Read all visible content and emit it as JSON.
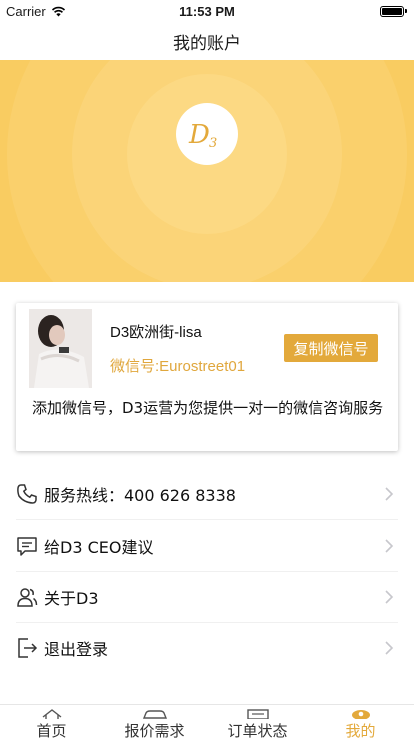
{
  "status_bar": {
    "carrier": "Carrier",
    "time": "11:53 PM"
  },
  "nav": {
    "title": "我的账户"
  },
  "banner": {
    "logo_text": "D3"
  },
  "profile_card": {
    "name": "D3欧洲街-lisa",
    "wechat_id": "微信号:Eurostreet01",
    "copy_button": "复制微信号",
    "description": "添加微信号，D3运营为您提供一对一的微信咨询服务"
  },
  "menu": [
    {
      "label": "服务热线：400 626 8338",
      "icon": "phone-icon"
    },
    {
      "label": "给D3 CEO建议",
      "icon": "chat-icon"
    },
    {
      "label": "关于D3",
      "icon": "users-icon"
    },
    {
      "label": "退出登录",
      "icon": "logout-icon"
    }
  ],
  "tabs": [
    {
      "label": "首页",
      "icon": "home-icon"
    },
    {
      "label": "报价需求",
      "icon": "car-icon"
    },
    {
      "label": "订单状态",
      "icon": "order-icon"
    },
    {
      "label": "我的",
      "icon": "profile-icon",
      "active": true
    }
  ],
  "colors": {
    "accent": "#e3a93b",
    "banner": "#f8c857",
    "wechat_text": "#e0a73d"
  }
}
